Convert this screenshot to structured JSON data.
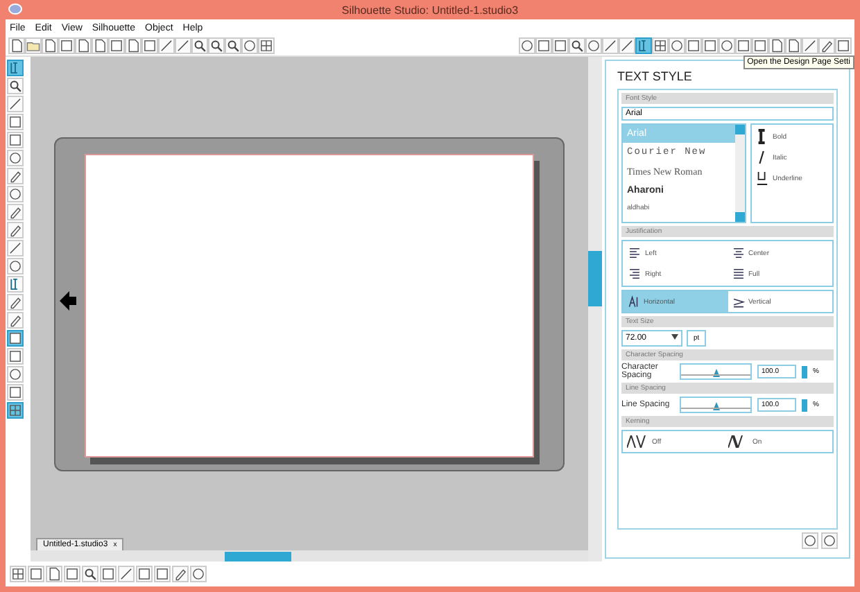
{
  "window": {
    "title": "Silhouette Studio: Untitled-1.studio3"
  },
  "menu": [
    "File",
    "Edit",
    "View",
    "Silhouette",
    "Object",
    "Help"
  ],
  "tooltip": "Open the Design Page Setti",
  "document_tab": {
    "label": "Untitled-1.studio3",
    "close": "x"
  },
  "panel": {
    "title": "TEXT STYLE",
    "font_style": {
      "heading": "Font Style",
      "value": "Arial",
      "fonts": [
        {
          "name": "Arial",
          "kind": "sans",
          "selected": true
        },
        {
          "name": "Courier New",
          "kind": "mono",
          "selected": false
        },
        {
          "name": "Times New Roman",
          "kind": "serif",
          "selected": false
        },
        {
          "name": "Aharoni",
          "kind": "heavy",
          "selected": false
        },
        {
          "name": "aldhabi",
          "kind": "small",
          "selected": false
        }
      ],
      "styles": [
        {
          "label": "Bold",
          "kind": "bold"
        },
        {
          "label": "Italic",
          "kind": "italic"
        },
        {
          "label": "Underline",
          "kind": "underline"
        }
      ]
    },
    "justification": {
      "heading": "Justification",
      "options": [
        {
          "label": "Left",
          "kind": "left"
        },
        {
          "label": "Center",
          "kind": "center"
        },
        {
          "label": "Right",
          "kind": "right"
        },
        {
          "label": "Full",
          "kind": "full"
        }
      ],
      "orientation": [
        {
          "label": "Horizontal",
          "kind": "horizontal",
          "selected": true
        },
        {
          "label": "Vertical",
          "kind": "vertical",
          "selected": false
        }
      ]
    },
    "text_size": {
      "heading": "Text Size",
      "value": "72.00",
      "unit": "pt"
    },
    "spacing": [
      {
        "heading": "Character Spacing",
        "label": "Character Spacing",
        "level": 0.5,
        "value": "100.0",
        "unit": "%"
      },
      {
        "heading": "Line Spacing",
        "label": "Line Spacing",
        "level": 0.5,
        "value": "100.0",
        "unit": "%"
      }
    ],
    "kerning": {
      "heading": "Kerning",
      "options": [
        {
          "label": "Off",
          "kind": "off"
        },
        {
          "label": "On",
          "kind": "on"
        }
      ]
    }
  }
}
